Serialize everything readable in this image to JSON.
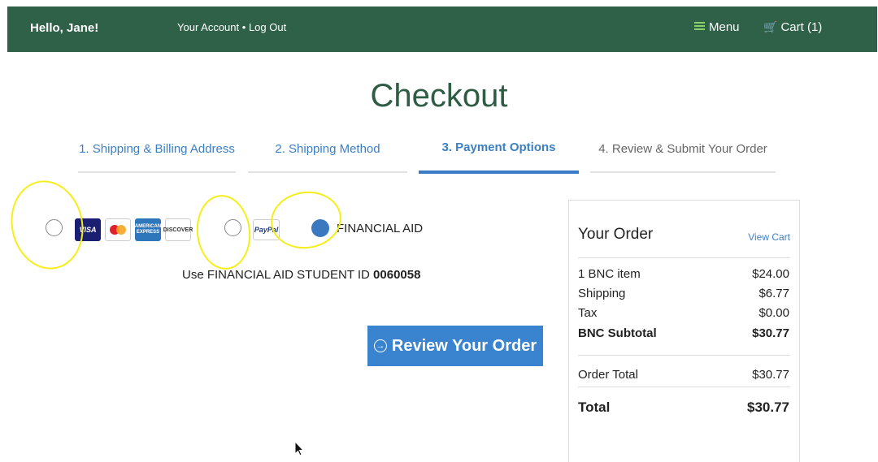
{
  "header": {
    "greeting": "Hello, Jane!",
    "your_account": "Your Account",
    "separator": "•",
    "log_out": "Log Out",
    "menu_label": "Menu",
    "cart_label": "Cart (1)"
  },
  "page": {
    "title": "Checkout"
  },
  "steps": [
    {
      "label": "1. Shipping & Billing Address",
      "state": "link"
    },
    {
      "label": "2. Shipping Method",
      "state": "link"
    },
    {
      "label": "3. Payment Options",
      "state": "active"
    },
    {
      "label": "4. Review & Submit Your Order",
      "state": "muted"
    }
  ],
  "payment": {
    "cards": {
      "visa": "VISA",
      "amex": "AMERICAN EXPRESS",
      "discover": "DISCOVER"
    },
    "paypal": "PayPal",
    "financial_aid_label": "FINANCIAL AID",
    "selected_option": "financial-aid",
    "note_prefix": "Use FINANCIAL AID STUDENT ID",
    "student_id": "0060058",
    "review_button": "Review Your Order"
  },
  "order": {
    "title": "Your Order",
    "view_cart": "View Cart",
    "lines": [
      {
        "label": "1 BNC item",
        "value": "$24.00"
      },
      {
        "label": "Shipping",
        "value": "$6.77"
      },
      {
        "label": "Tax",
        "value": "$0.00"
      },
      {
        "label": "BNC Subtotal",
        "value": "$30.77"
      }
    ],
    "order_total_label": "Order Total",
    "order_total_value": "$30.77",
    "total_label": "Total",
    "total_value": "$30.77"
  },
  "colors": {
    "header_bg": "#2e6147",
    "accent_blue": "#3a83cf",
    "title_green": "#2e5c44",
    "highlight_yellow": "#f5ee1a"
  }
}
